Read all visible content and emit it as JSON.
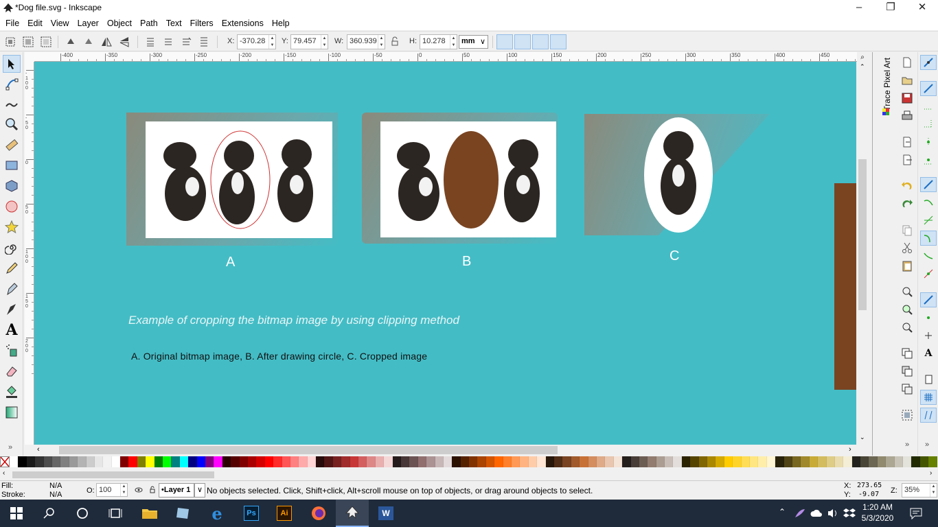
{
  "window": {
    "title": "*Dog file.svg - Inkscape"
  },
  "menu": [
    "File",
    "Edit",
    "View",
    "Layer",
    "Object",
    "Path",
    "Text",
    "Filters",
    "Extensions",
    "Help"
  ],
  "controls": {
    "x_label": "X:",
    "x_value": "-370.28",
    "y_label": "Y:",
    "y_value": "79.457",
    "w_label": "W:",
    "w_value": "360.939",
    "h_label": "H:",
    "h_value": "10.278",
    "unit": "mm"
  },
  "ruler": {
    "h_ticks": [
      "-400",
      "-350",
      "-300",
      "-250",
      "-200",
      "-150",
      "-100",
      "-50",
      "0",
      "50",
      "100",
      "150",
      "200",
      "250",
      "300",
      "350",
      "400",
      "450"
    ],
    "v_ticks": [
      "-100",
      "-50",
      "0",
      "50",
      "100",
      "150",
      "200"
    ]
  },
  "canvas": {
    "captions": {
      "a": "A",
      "b": "B",
      "c": "C"
    },
    "italic_note": "Example of cropping the bitmap image by using clipping method",
    "body_note": "A. Original bitmap image, B. After drawing circle, C. Cropped image",
    "background_color": "#44bcc5",
    "brown_color": "#7a4421"
  },
  "dock": {
    "tab_label": "Trace Pixel Art"
  },
  "status": {
    "fill_label": "Fill:",
    "fill_value": "N/A",
    "stroke_label": "Stroke:",
    "stroke_value": "N/A",
    "opacity_label": "O:",
    "opacity_value": "100",
    "layer": "•Layer 1",
    "message": "No objects selected. Click, Shift+click, Alt+scroll mouse on top of objects, or drag around objects to select.",
    "x_label": "X:",
    "x_value": "273.65",
    "y_label": "Y:",
    "y_value": "-9.07",
    "zoom_label": "Z:",
    "zoom_value": "35%"
  },
  "taskbar": {
    "time": "1:20 AM",
    "date": "5/3/2020"
  },
  "palette": [
    "#ffffff",
    "#000000",
    "#1a1a1a",
    "#333333",
    "#4d4d4d",
    "#666666",
    "#808080",
    "#999999",
    "#b3b3b3",
    "#cccccc",
    "#e6e6e6",
    "#f2f2f2",
    "#ffffff",
    "#800000",
    "#ff0000",
    "#808000",
    "#ffff00",
    "#008000",
    "#00ff00",
    "#008080",
    "#00ffff",
    "#000080",
    "#0000ff",
    "#800080",
    "#ff00ff",
    "#2b0000",
    "#550000",
    "#800000",
    "#aa0000",
    "#d40000",
    "#ff0000",
    "#ff2a2a",
    "#ff5555",
    "#ff8080",
    "#ffaaaa",
    "#ffd5d5",
    "#280b0b",
    "#501616",
    "#782121",
    "#a02c2c",
    "#c83737",
    "#d35f5f",
    "#de8787",
    "#e9afaf",
    "#f4d7d7",
    "#241c1c",
    "#483737",
    "#6c5353",
    "#916f6f",
    "#ac9393",
    "#c8b7b7",
    "#e3dbdb",
    "#2b1100",
    "#552200",
    "#803300",
    "#aa4400",
    "#d45500",
    "#ff6600",
    "#ff7f2a",
    "#ff9955",
    "#ffb380",
    "#ffccaa",
    "#ffe6d5",
    "#28170b",
    "#502d16",
    "#784421",
    "#a05a2c",
    "#c87137",
    "#d38d5f",
    "#deaa87",
    "#e9c6af",
    "#f4e3d7",
    "#241f1c",
    "#483e37",
    "#6c5d53",
    "#917c6f",
    "#ac9d93",
    "#c8beb7",
    "#e3dedb",
    "#2b2200",
    "#554400",
    "#806600",
    "#aa8800",
    "#d4aa00",
    "#ffcc00",
    "#ffd42a",
    "#ffdd55",
    "#ffe680",
    "#ffeeaa",
    "#fff6d5",
    "#28220b",
    "#504416",
    "#786721",
    "#a0892c",
    "#c8ab37",
    "#d3bc5f",
    "#decd87",
    "#e9ddaf",
    "#f4eed7",
    "#24221c",
    "#484537",
    "#6c6753",
    "#918a6f",
    "#aca793",
    "#c8c4b7",
    "#e3e2db",
    "#222b00",
    "#445500",
    "#668000"
  ]
}
